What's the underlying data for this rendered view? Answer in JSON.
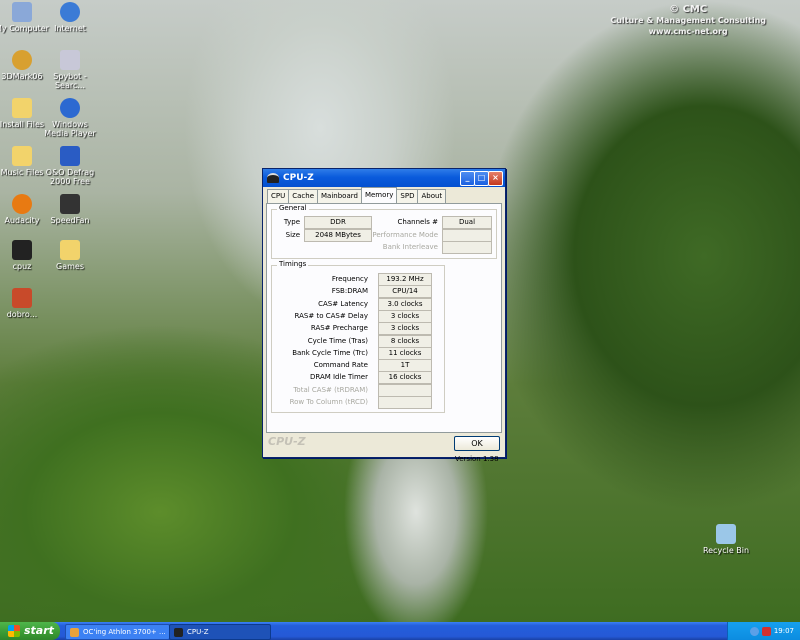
{
  "watermark": {
    "line1": "© CMC",
    "line2": "Culture & Management Consulting",
    "line3": "www.cmc-net.org"
  },
  "desktop_icons": [
    {
      "label": "My Computer",
      "icon": "my-computer-icon",
      "color": "#8aa8d8"
    },
    {
      "label": "Internet",
      "icon": "internet-explorer-icon",
      "color": "#3b7bd6"
    },
    {
      "label": "3DMark06",
      "icon": "3dmark-icon",
      "color": "#d8a030"
    },
    {
      "label": "Spybot - Searc...",
      "icon": "spybot-icon",
      "color": "#c8c8d8"
    },
    {
      "label": "Install Files",
      "icon": "folder-icon",
      "color": "#f2d36b"
    },
    {
      "label": "Windows Media Player",
      "icon": "media-player-icon",
      "color": "#2c69d1"
    },
    {
      "label": "Music Files",
      "icon": "folder-icon",
      "color": "#f2d36b"
    },
    {
      "label": "O&O Defrag 2000 Free",
      "icon": "defrag-icon",
      "color": "#2a5cc4"
    },
    {
      "label": "Audacity",
      "icon": "audacity-icon",
      "color": "#e87a12"
    },
    {
      "label": "SpeedFan",
      "icon": "speedfan-icon",
      "color": "#333333"
    },
    {
      "label": "cpuz",
      "icon": "cpuz-icon",
      "color": "#222222"
    },
    {
      "label": "Games",
      "icon": "folder-icon",
      "color": "#f2d36b"
    },
    {
      "label": "dobro...",
      "icon": "document-icon",
      "color": "#c84a2a"
    },
    {
      "label": "Recycle Bin",
      "icon": "recycle-bin-icon",
      "color": "#9bc7e8"
    }
  ],
  "window": {
    "title": "CPU-Z",
    "tabs": [
      "CPU",
      "Cache",
      "Mainboard",
      "Memory",
      "SPD",
      "About"
    ],
    "active_tab": "Memory",
    "general": {
      "title": "General",
      "type_label": "Type",
      "type_value": "DDR",
      "size_label": "Size",
      "size_value": "2048 MBytes",
      "channels_label": "Channels #",
      "channels_value": "Dual",
      "perf_mode_label": "Performance Mode",
      "perf_mode_value": "",
      "bank_interleave_label": "Bank Interleave",
      "bank_interleave_value": ""
    },
    "timings": {
      "title": "Timings",
      "rows": [
        {
          "label": "Frequency",
          "value": "193.2 MHz",
          "dim": false
        },
        {
          "label": "FSB:DRAM",
          "value": "CPU/14",
          "dim": false
        },
        {
          "label": "CAS# Latency",
          "value": "3.0 clocks",
          "dim": false
        },
        {
          "label": "RAS# to CAS# Delay",
          "value": "3 clocks",
          "dim": false
        },
        {
          "label": "RAS# Precharge",
          "value": "3 clocks",
          "dim": false
        },
        {
          "label": "Cycle Time (Tras)",
          "value": "8 clocks",
          "dim": false
        },
        {
          "label": "Bank Cycle Time (Trc)",
          "value": "11 clocks",
          "dim": false
        },
        {
          "label": "Command Rate",
          "value": "1T",
          "dim": false
        },
        {
          "label": "DRAM Idle Timer",
          "value": "16 clocks",
          "dim": false
        },
        {
          "label": "Total CAS# (tRDRAM)",
          "value": "",
          "dim": true
        },
        {
          "label": "Row To Column (tRCD)",
          "value": "",
          "dim": true
        }
      ]
    },
    "version": "Version 1.38",
    "brand": "CPU-Z",
    "ok_label": "OK"
  },
  "taskbar": {
    "start_label": "start",
    "tasks": [
      {
        "label": "OC'ing Athlon 3700+ ...",
        "icon": "browser-icon"
      },
      {
        "label": "CPU-Z",
        "icon": "cpuz-icon"
      }
    ],
    "language": "EN",
    "clock": "19:07"
  }
}
